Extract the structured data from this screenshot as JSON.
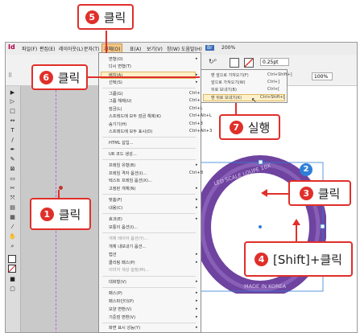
{
  "menubar": {
    "logo": "Id",
    "items": [
      "파일(F)",
      "편집(E)",
      "레이아웃(L)",
      "문자(T)",
      "개체(O)",
      "표(A)",
      "보기(V)",
      "창(W)",
      "도움말(H)",
      "Br",
      "200%"
    ]
  },
  "object_menu": {
    "items": [
      {
        "label": "변형(O)",
        "shortcut": ""
      },
      {
        "label": "다시 변형(T)",
        "shortcut": ""
      },
      {
        "label": "배치(A)",
        "shortcut": ""
      },
      {
        "label": "선택(S)",
        "shortcut": ""
      },
      {
        "label": "그룹(G)",
        "shortcut": "Ctrl+G"
      },
      {
        "label": "그룹 해제(U)",
        "shortcut": "Ctrl+Shift+G"
      },
      {
        "label": "잠금(L)",
        "shortcut": "Ctrl+L"
      },
      {
        "label": "스프레드에 모두 잠금 해제(K)",
        "shortcut": "Ctrl+Alt+L"
      },
      {
        "label": "숨기기(H)",
        "shortcut": "Ctrl+3"
      },
      {
        "label": "스프레드에 모두 표시(D)",
        "shortcut": "Ctrl+Alt+3"
      },
      {
        "label": "HTML 삽입...",
        "shortcut": ""
      },
      {
        "label": "UR 코드 생성...",
        "shortcut": ""
      },
      {
        "label": "프레임 유형(B)",
        "shortcut": ""
      },
      {
        "label": "프레임 격자 옵션(I)...",
        "shortcut": "Ctrl+B"
      },
      {
        "label": "텍스트 프레임 옵션(X)...",
        "shortcut": "Ctrl+B"
      },
      {
        "label": "고정된 개체(N)",
        "shortcut": ""
      },
      {
        "label": "맞춤(F)",
        "shortcut": ""
      },
      {
        "label": "내용(C)",
        "shortcut": ""
      },
      {
        "label": "효과(E)",
        "shortcut": ""
      },
      {
        "label": "모퉁이 옵션(I)...",
        "shortcut": ""
      },
      {
        "label": "개체 레이어 옵션(Y)...",
        "shortcut": ""
      },
      {
        "label": "개체 내보내기 옵션...",
        "shortcut": ""
      },
      {
        "label": "캡션",
        "shortcut": ""
      },
      {
        "label": "클리핑 패스(P)",
        "shortcut": ""
      },
      {
        "label": "이미지 색상 설정(M)...",
        "shortcut": ""
      },
      {
        "label": "대화형(V)",
        "shortcut": ""
      },
      {
        "label": "패스(P)",
        "shortcut": ""
      },
      {
        "label": "패스파인더(P)",
        "shortcut": ""
      },
      {
        "label": "모양 변환(V)",
        "shortcut": ""
      },
      {
        "label": "기준점 변환(V)",
        "shortcut": ""
      },
      {
        "label": "화면 표시 성능(Y)",
        "shortcut": ""
      }
    ]
  },
  "arrange_submenu": {
    "items": [
      {
        "label": "맨 앞으로 가져오기(F)",
        "shortcut": "Ctrl+Shift+]"
      },
      {
        "label": "앞으로 가져오기(W)",
        "shortcut": "Ctrl+]"
      },
      {
        "label": "뒤로 보내기(B)",
        "shortcut": "Ctrl+["
      },
      {
        "label": "맨 뒤로 보내기(K)",
        "shortcut": "Ctrl+Shift+["
      }
    ]
  },
  "options_bar": {
    "stroke_weight": "0.25pt",
    "zoom_percent": "100%"
  },
  "ring": {
    "text_top": "LED SCALE LOUPE 10X",
    "text_bottom": "MADE IN KOREA"
  },
  "callouts": [
    {
      "num": "1",
      "text": "클릭"
    },
    {
      "num": "2",
      "text": ""
    },
    {
      "num": "3",
      "text": "클릭"
    },
    {
      "num": "4",
      "text": "[Shift]+클릭"
    },
    {
      "num": "5",
      "text": "클릭"
    },
    {
      "num": "6",
      "text": "클릭"
    },
    {
      "num": "7",
      "text": "실행"
    }
  ],
  "colors": {
    "callout_red": "#e02f2a",
    "ring_purple": "#7b4aa3",
    "selection_blue": "#2f7fd8",
    "menu_highlight": "#fdf0c8"
  }
}
